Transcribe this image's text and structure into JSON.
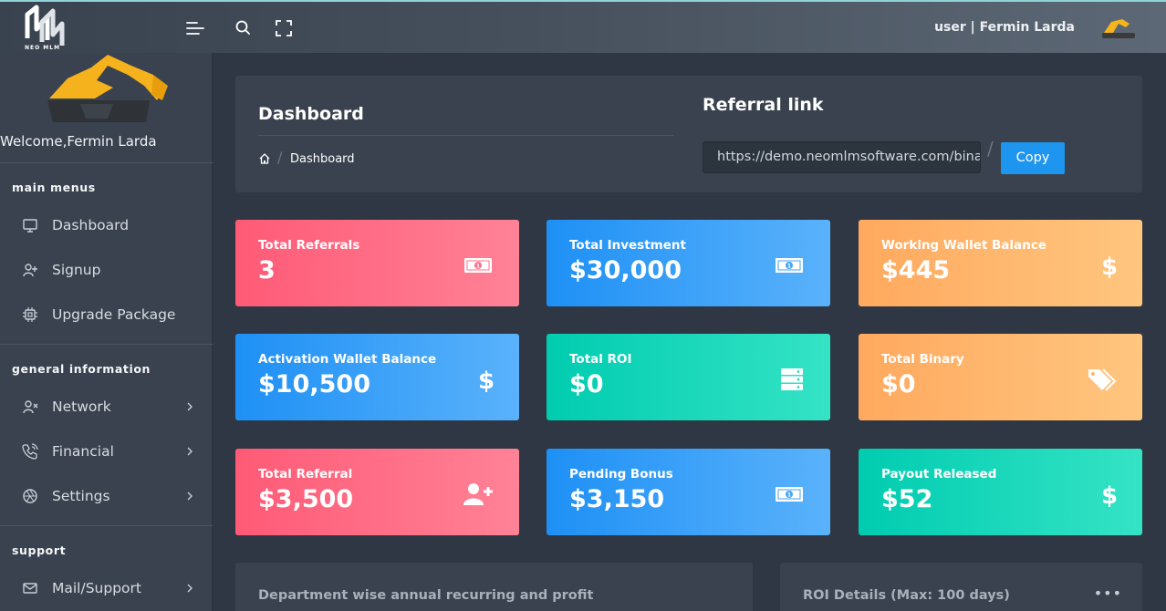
{
  "brand": {
    "logo_text": "NEO MLM",
    "side_logo_text": "EXCAVATOR"
  },
  "topbar": {
    "user_label": "user | Fermin Larda"
  },
  "sidebar": {
    "welcome": "Welcome,Fermin Larda",
    "sections": [
      {
        "heading": "main menus",
        "items": [
          "Dashboard",
          "Signup",
          "Upgrade Package"
        ]
      },
      {
        "heading": "general information",
        "items": [
          "Network",
          "Financial",
          "Settings"
        ]
      },
      {
        "heading": "support",
        "items": [
          "Mail/Support"
        ]
      }
    ]
  },
  "header": {
    "title": "Dashboard",
    "breadcrumb_current": "Dashboard",
    "referral_title": "Referral link",
    "referral_url": "https://demo.neomlmsoftware.com/binary/register",
    "copy_label": "Copy"
  },
  "stats": [
    {
      "label": "Total Referrals",
      "value": "3",
      "icon": "money-bill-icon",
      "color": "#ff6a84"
    },
    {
      "label": "Total Investment",
      "value": "$30,000",
      "icon": "money-bill-icon",
      "color": "#3aa2f8"
    },
    {
      "label": "Working Wallet Balance",
      "value": "$445",
      "icon": "dollar-icon",
      "color": "#ffb76d"
    },
    {
      "label": "Activation Wallet Balance",
      "value": "$10,500",
      "icon": "dollar-icon",
      "color": "#3aa2f8"
    },
    {
      "label": "Total ROI",
      "value": "$0",
      "icon": "server-icon",
      "color": "#16d6b9"
    },
    {
      "label": "Total Binary",
      "value": "$0",
      "icon": "tags-icon",
      "color": "#ffb76d"
    },
    {
      "label": "Total Referral",
      "value": "$3,500",
      "icon": "user-plus-icon",
      "color": "#ff6a84"
    },
    {
      "label": "Pending Bonus",
      "value": "$3,150",
      "icon": "money-bill-icon",
      "color": "#3aa2f8"
    },
    {
      "label": "Payout Released",
      "value": "$52",
      "icon": "dollar-icon",
      "color": "#16d6b9"
    }
  ],
  "bottom": {
    "left_title": "Department wise annual recurring and profit",
    "right_title": "ROI Details (Max: 100 days)"
  }
}
